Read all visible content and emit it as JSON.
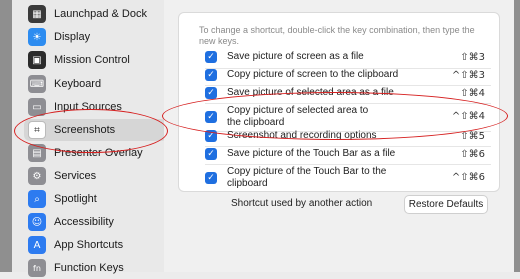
{
  "sidebar": {
    "items": [
      {
        "label": "Launchpad & Dock",
        "icon": "launchpad-dock-icon",
        "glyph": "▦",
        "color": "#3a3a3a"
      },
      {
        "label": "Display",
        "icon": "display-icon",
        "glyph": "☀",
        "color": "#2d8cf0"
      },
      {
        "label": "Mission Control",
        "icon": "mission-control-icon",
        "glyph": "▣",
        "color": "#2b2b2b"
      },
      {
        "label": "Keyboard",
        "icon": "keyboard-icon",
        "glyph": "⌨",
        "color": "#8e8e93"
      },
      {
        "label": "Input Sources",
        "icon": "input-sources-icon",
        "glyph": "▭",
        "color": "#8e8e93"
      },
      {
        "label": "Screenshots",
        "icon": "screenshots-icon",
        "glyph": "⌗",
        "color": "#3a3a3a",
        "selected": true
      },
      {
        "label": "Presenter Overlay",
        "icon": "presenter-overlay-icon",
        "glyph": "▤",
        "color": "#8e8e93"
      },
      {
        "label": "Services",
        "icon": "services-icon",
        "glyph": "⚙",
        "color": "#8e8e93"
      },
      {
        "label": "Spotlight",
        "icon": "spotlight-icon",
        "glyph": "⌕",
        "color": "#2d7bf0"
      },
      {
        "label": "Accessibility",
        "icon": "accessibility-icon",
        "glyph": "☺",
        "color": "#2d7bf0"
      },
      {
        "label": "App Shortcuts",
        "icon": "app-shortcuts-icon",
        "glyph": "A",
        "color": "#2d7bf0"
      },
      {
        "label": "Function Keys",
        "icon": "function-keys-icon",
        "glyph": "fn",
        "color": "#8e8e93"
      }
    ]
  },
  "main": {
    "hint": "To change a shortcut, double-click the key combination, then type the new keys.",
    "shortcuts": [
      {
        "label": "Save picture of screen as a file",
        "keys": "⇧⌘3",
        "checked": true
      },
      {
        "label": "Copy picture of screen to the clipboard",
        "keys": "^⇧⌘3",
        "checked": true
      },
      {
        "label": "Save picture of selected area as a file",
        "keys": "⇧⌘4",
        "checked": true
      },
      {
        "label": "Copy picture of selected area to\nthe clipboard",
        "keys": "^⇧⌘4",
        "checked": true
      },
      {
        "label": "Screenshot and recording options",
        "keys": "⇧⌘5",
        "checked": true
      },
      {
        "label": "Save picture of the Touch Bar as a file",
        "keys": "⇧⌘6",
        "checked": true
      },
      {
        "label": "Copy picture of the Touch Bar to the\nclipboard",
        "keys": "^⇧⌘6",
        "checked": true
      }
    ],
    "footer_text": "Shortcut used by another action",
    "restore_label": "Restore Defaults"
  },
  "colors": {
    "accent": "#1f6fe0",
    "annotation": "#d62020"
  }
}
